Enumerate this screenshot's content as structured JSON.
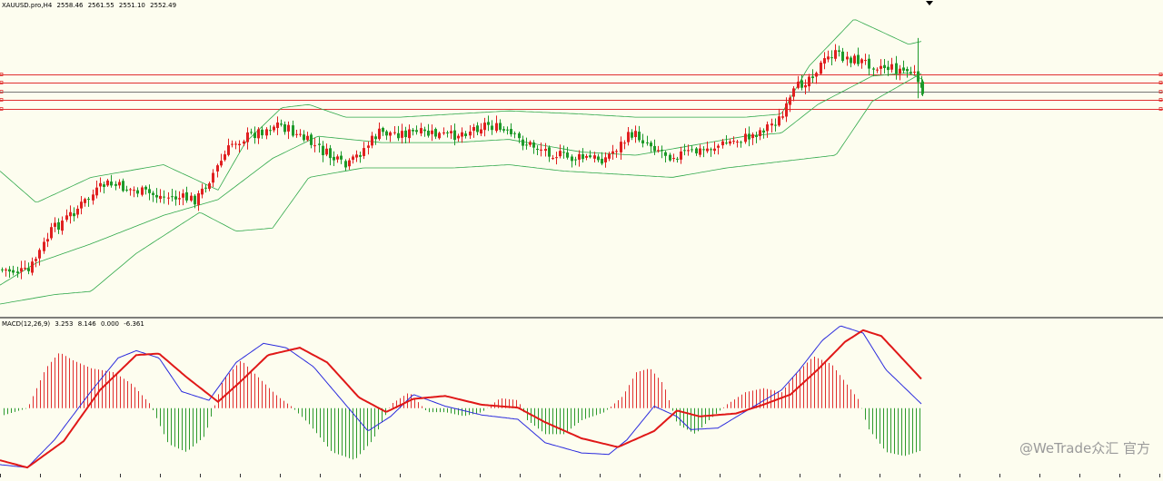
{
  "header": {
    "symbol": "XAUUSD.pro,H4",
    "open": "2558.46",
    "high": "2561.55",
    "low": "2551.10",
    "close": "2552.49"
  },
  "macd_header": {
    "label": "MACD(12,26,9)",
    "main": "3.253",
    "signal": "8.146",
    "v1": "0.000",
    "v2": "-6.361"
  },
  "watermark": "@WeTrade众汇 官方",
  "colors": {
    "background": "#fdfdef",
    "bull": "#e02020",
    "bear": "#1e9a2a",
    "bands": "#2fa84a",
    "hline": "#e03030",
    "macd_main": "#2b2bdd",
    "macd_signal": "#e01818",
    "hist_pos": "#e03030",
    "hist_neg": "#2e9a2e"
  },
  "chart_data": [
    {
      "type": "line",
      "title": "XAUUSD.pro,H4",
      "description": "Candlestick price chart with Bollinger Bands; keypoints y ∈ [0,1] (0 = top of pane, 1 = bottom)",
      "candle_path": [
        [
          0,
          0.85
        ],
        [
          35,
          0.86
        ],
        [
          60,
          0.73
        ],
        [
          120,
          0.58
        ],
        [
          180,
          0.62
        ],
        [
          220,
          0.63
        ],
        [
          260,
          0.45
        ],
        [
          310,
          0.39
        ],
        [
          350,
          0.46
        ],
        [
          385,
          0.53
        ],
        [
          420,
          0.42
        ],
        [
          460,
          0.42
        ],
        [
          500,
          0.43
        ],
        [
          540,
          0.39
        ],
        [
          580,
          0.45
        ],
        [
          630,
          0.5
        ],
        [
          670,
          0.5
        ],
        [
          700,
          0.42
        ],
        [
          740,
          0.49
        ],
        [
          770,
          0.48
        ],
        [
          830,
          0.43
        ],
        [
          865,
          0.37
        ],
        [
          880,
          0.28
        ],
        [
          920,
          0.17
        ],
        [
          960,
          0.2
        ],
        [
          1010,
          0.23
        ],
        [
          1015,
          0.28
        ]
      ],
      "band_upper": [
        [
          0,
          0.54
        ],
        [
          40,
          0.64
        ],
        [
          100,
          0.56
        ],
        [
          180,
          0.52
        ],
        [
          240,
          0.6
        ],
        [
          270,
          0.45
        ],
        [
          310,
          0.34
        ],
        [
          340,
          0.33
        ],
        [
          380,
          0.37
        ],
        [
          440,
          0.37
        ],
        [
          500,
          0.36
        ],
        [
          560,
          0.35
        ],
        [
          640,
          0.36
        ],
        [
          700,
          0.37
        ],
        [
          760,
          0.37
        ],
        [
          820,
          0.37
        ],
        [
          860,
          0.36
        ],
        [
          890,
          0.21
        ],
        [
          940,
          0.06
        ],
        [
          1000,
          0.14
        ],
        [
          1015,
          0.13
        ]
      ],
      "band_middle": [
        [
          0,
          0.9
        ],
        [
          40,
          0.83
        ],
        [
          100,
          0.77
        ],
        [
          180,
          0.68
        ],
        [
          240,
          0.63
        ],
        [
          300,
          0.5
        ],
        [
          350,
          0.43
        ],
        [
          420,
          0.45
        ],
        [
          500,
          0.45
        ],
        [
          560,
          0.44
        ],
        [
          640,
          0.48
        ],
        [
          700,
          0.49
        ],
        [
          760,
          0.46
        ],
        [
          820,
          0.43
        ],
        [
          860,
          0.42
        ],
        [
          900,
          0.33
        ],
        [
          960,
          0.24
        ],
        [
          1000,
          0.23
        ],
        [
          1015,
          0.25
        ]
      ],
      "band_lower": [
        [
          0,
          0.96
        ],
        [
          60,
          0.93
        ],
        [
          100,
          0.92
        ],
        [
          150,
          0.8
        ],
        [
          220,
          0.67
        ],
        [
          260,
          0.73
        ],
        [
          300,
          0.72
        ],
        [
          340,
          0.56
        ],
        [
          400,
          0.53
        ],
        [
          500,
          0.53
        ],
        [
          560,
          0.52
        ],
        [
          620,
          0.54
        ],
        [
          680,
          0.55
        ],
        [
          740,
          0.56
        ],
        [
          800,
          0.53
        ],
        [
          860,
          0.51
        ],
        [
          920,
          0.49
        ],
        [
          960,
          0.32
        ],
        [
          1015,
          0.23
        ]
      ],
      "horizontal_lines": [
        0.235,
        0.26,
        0.29,
        0.315,
        0.345
      ]
    },
    {
      "type": "line",
      "title": "MACD(12,26,9)",
      "series": [
        {
          "name": "main",
          "points": [
            [
              0,
              0.95
            ],
            [
              30,
              0.97
            ],
            [
              60,
              0.78
            ],
            [
              100,
              0.45
            ],
            [
              130,
              0.22
            ],
            [
              150,
              0.17
            ],
            [
              175,
              0.22
            ],
            [
              200,
              0.45
            ],
            [
              230,
              0.51
            ],
            [
              260,
              0.25
            ],
            [
              290,
              0.12
            ],
            [
              315,
              0.15
            ],
            [
              345,
              0.28
            ],
            [
              375,
              0.5
            ],
            [
              405,
              0.72
            ],
            [
              430,
              0.62
            ],
            [
              455,
              0.47
            ],
            [
              490,
              0.55
            ],
            [
              530,
              0.61
            ],
            [
              570,
              0.64
            ],
            [
              600,
              0.8
            ],
            [
              640,
              0.87
            ],
            [
              670,
              0.88
            ],
            [
              690,
              0.78
            ],
            [
              720,
              0.55
            ],
            [
              745,
              0.62
            ],
            [
              760,
              0.71
            ],
            [
              790,
              0.7
            ],
            [
              830,
              0.55
            ],
            [
              860,
              0.44
            ],
            [
              880,
              0.3
            ],
            [
              905,
              0.1
            ],
            [
              925,
              0.0
            ],
            [
              950,
              0.05
            ],
            [
              975,
              0.3
            ],
            [
              1015,
              0.54
            ]
          ]
        },
        {
          "name": "signal",
          "points": [
            [
              0,
              0.92
            ],
            [
              30,
              0.97
            ],
            [
              70,
              0.79
            ],
            [
              110,
              0.44
            ],
            [
              150,
              0.2
            ],
            [
              175,
              0.19
            ],
            [
              205,
              0.35
            ],
            [
              240,
              0.52
            ],
            [
              265,
              0.38
            ],
            [
              295,
              0.2
            ],
            [
              330,
              0.15
            ],
            [
              360,
              0.25
            ],
            [
              395,
              0.49
            ],
            [
              425,
              0.59
            ],
            [
              455,
              0.5
            ],
            [
              490,
              0.48
            ],
            [
              530,
              0.54
            ],
            [
              570,
              0.56
            ],
            [
              600,
              0.66
            ],
            [
              640,
              0.77
            ],
            [
              680,
              0.83
            ],
            [
              720,
              0.72
            ],
            [
              745,
              0.58
            ],
            [
              770,
              0.62
            ],
            [
              810,
              0.6
            ],
            [
              840,
              0.54
            ],
            [
              870,
              0.47
            ],
            [
              900,
              0.3
            ],
            [
              930,
              0.11
            ],
            [
              950,
              0.03
            ],
            [
              970,
              0.07
            ],
            [
              1015,
              0.37
            ]
          ]
        }
      ],
      "histogram": [
        [
          0,
          -0.04
        ],
        [
          30,
          0.0
        ],
        [
          50,
          0.2
        ],
        [
          65,
          0.28
        ],
        [
          80,
          0.24
        ],
        [
          100,
          0.2
        ],
        [
          125,
          0.18
        ],
        [
          145,
          0.12
        ],
        [
          165,
          0.02
        ],
        [
          185,
          -0.18
        ],
        [
          205,
          -0.22
        ],
        [
          225,
          -0.14
        ],
        [
          245,
          0.14
        ],
        [
          265,
          0.24
        ],
        [
          285,
          0.15
        ],
        [
          305,
          0.06
        ],
        [
          320,
          0.01
        ],
        [
          340,
          -0.08
        ],
        [
          365,
          -0.22
        ],
        [
          390,
          -0.26
        ],
        [
          410,
          -0.16
        ],
        [
          430,
          0.02
        ],
        [
          450,
          0.08
        ],
        [
          470,
          -0.02
        ],
        [
          490,
          -0.02
        ],
        [
          510,
          -0.04
        ],
        [
          530,
          -0.02
        ],
        [
          550,
          0.05
        ],
        [
          570,
          0.04
        ],
        [
          580,
          -0.06
        ],
        [
          600,
          -0.13
        ],
        [
          620,
          -0.13
        ],
        [
          640,
          -0.06
        ],
        [
          665,
          -0.02
        ],
        [
          685,
          0.06
        ],
        [
          700,
          0.18
        ],
        [
          715,
          0.2
        ],
        [
          730,
          0.12
        ],
        [
          745,
          -0.08
        ],
        [
          765,
          -0.13
        ],
        [
          780,
          -0.06
        ],
        [
          800,
          0.02
        ],
        [
          820,
          0.08
        ],
        [
          840,
          0.1
        ],
        [
          860,
          0.08
        ],
        [
          875,
          0.17
        ],
        [
          895,
          0.26
        ],
        [
          915,
          0.22
        ],
        [
          935,
          0.1
        ],
        [
          945,
          0.04
        ],
        [
          955,
          -0.1
        ],
        [
          975,
          -0.22
        ],
        [
          995,
          -0.24
        ],
        [
          1015,
          -0.21
        ]
      ],
      "ylim": [
        -1,
        1
      ]
    }
  ]
}
